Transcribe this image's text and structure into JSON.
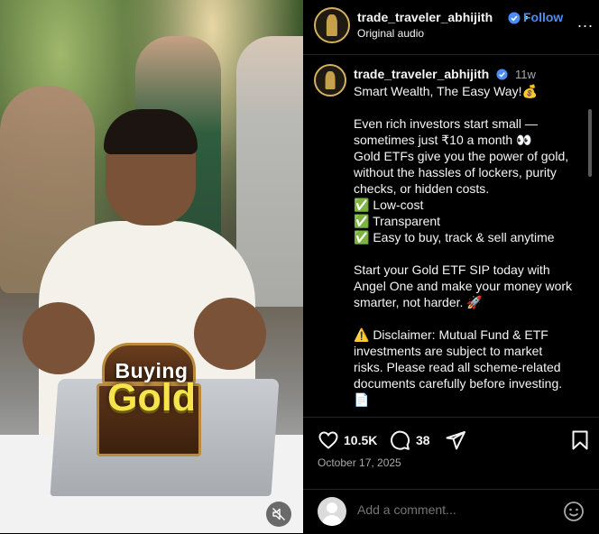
{
  "header": {
    "username": "trade_traveler_abhijith",
    "follow_label": "Follow",
    "audio": "Original audio",
    "more_label": "..."
  },
  "post": {
    "username": "trade_traveler_abhijith",
    "time_ago": "11w",
    "caption_lines": [
      "Smart Wealth, The Easy Way!💰",
      "",
      " Even rich investors start small —",
      "sometimes just ₹10 a month 👀",
      "Gold ETFs give you the power of gold,",
      "without the hassles of lockers, purity",
      "checks, or hidden costs.",
      "✅ Low-cost",
      "✅ Transparent",
      "✅ Easy to buy, track & sell anytime",
      "",
      "Start your Gold ETF SIP today with",
      "Angel One and make your money work",
      "smarter, not harder. 🚀",
      "",
      "⚠️ Disclaimer: Mutual Fund & ETF",
      "investments are subject to market",
      "risks. Please read all scheme-related",
      "documents carefully before investing.",
      "📄"
    ]
  },
  "media": {
    "overlay_small": "Buying",
    "overlay_big": "Gold"
  },
  "actions": {
    "likes": "10.5K",
    "comments": "38",
    "date": "October 17, 2025"
  },
  "comment_box": {
    "placeholder": "Add a comment..."
  },
  "colors": {
    "accent_blue": "#4a8df8",
    "background": "#000000",
    "muted_text": "#a8a8a8",
    "gold_text": "#f6e44a"
  }
}
